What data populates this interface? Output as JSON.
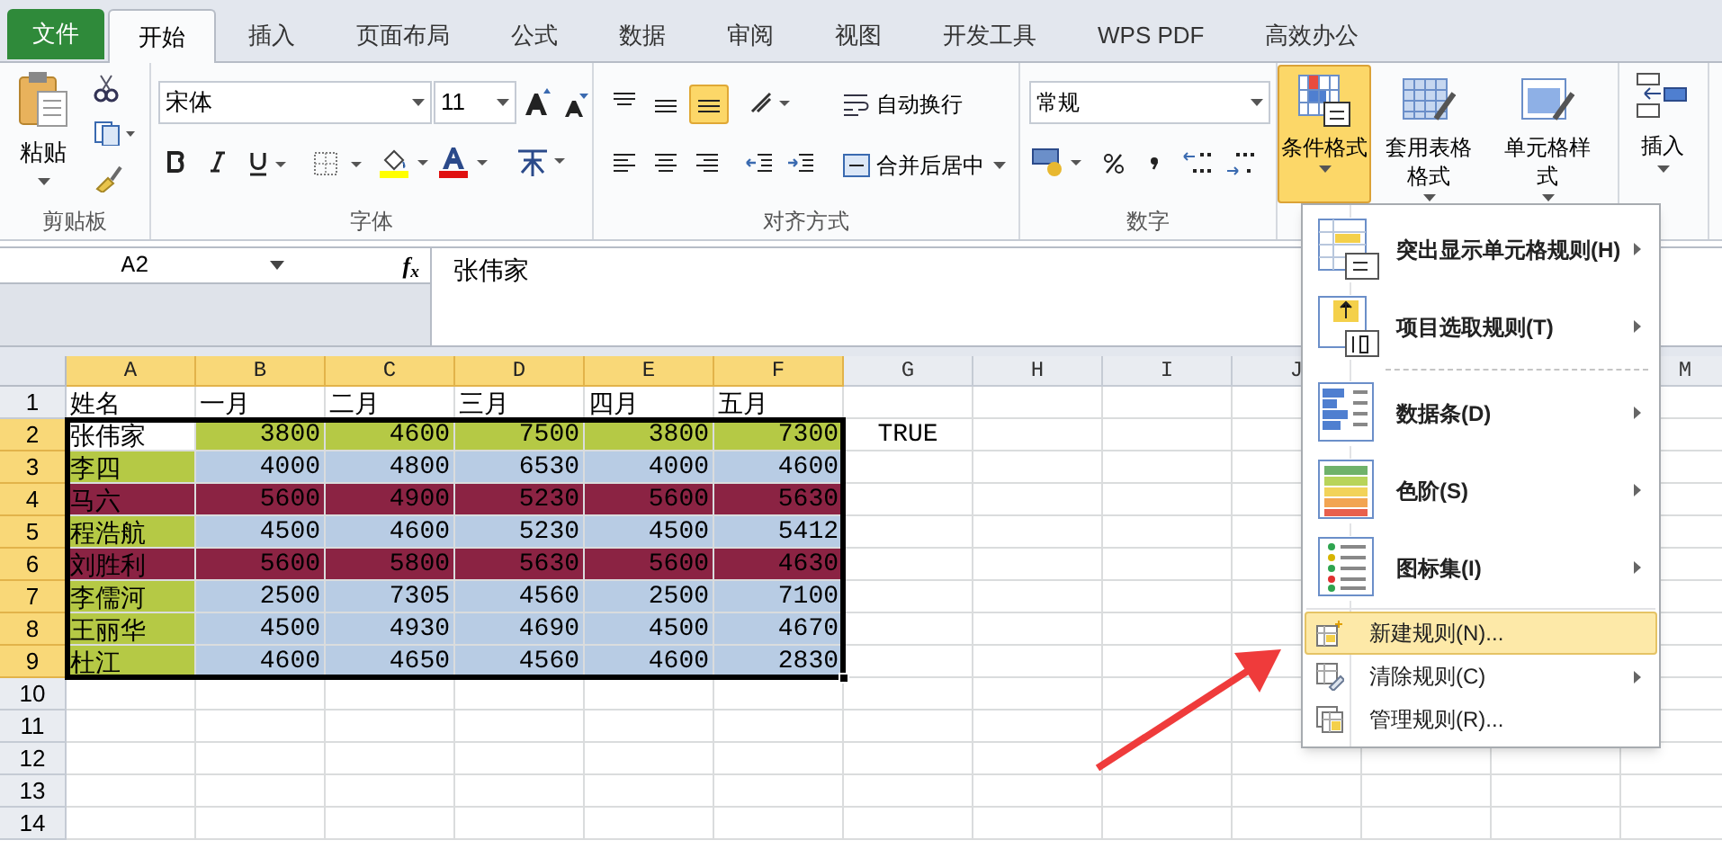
{
  "tabs": [
    {
      "label": "文件",
      "kind": "file",
      "selected": false
    },
    {
      "label": "开始",
      "kind": "tab",
      "selected": true
    },
    {
      "label": "插入",
      "kind": "tab",
      "selected": false
    },
    {
      "label": "页面布局",
      "kind": "tab",
      "selected": false
    },
    {
      "label": "公式",
      "kind": "tab",
      "selected": false
    },
    {
      "label": "数据",
      "kind": "tab",
      "selected": false
    },
    {
      "label": "审阅",
      "kind": "tab",
      "selected": false
    },
    {
      "label": "视图",
      "kind": "tab",
      "selected": false
    },
    {
      "label": "开发工具",
      "kind": "tab",
      "selected": false
    },
    {
      "label": "WPS PDF",
      "kind": "tab",
      "selected": false
    },
    {
      "label": "高效办公",
      "kind": "tab",
      "selected": false
    }
  ],
  "ribbon": {
    "clipboard": {
      "label": "剪贴板",
      "paste": "粘贴"
    },
    "font": {
      "label": "字体",
      "font_name": "宋体",
      "font_size": "11"
    },
    "alignment": {
      "label": "对齐方式",
      "wrap_text": "自动换行",
      "merge_center": "合并后居中"
    },
    "number": {
      "label": "数字",
      "format": "常规"
    },
    "styles": [
      {
        "label": "条件格式",
        "pressed": true
      },
      {
        "label": "套用表格格式",
        "pressed": false
      },
      {
        "label": "单元格样式",
        "pressed": false
      }
    ],
    "cells": {
      "insert": "插入"
    }
  },
  "name_box": "A2",
  "formula": "张伟家",
  "function_label": "f$_{x}$",
  "columns": [
    {
      "label": "A",
      "selected": true
    },
    {
      "label": "B",
      "selected": true
    },
    {
      "label": "C",
      "selected": true
    },
    {
      "label": "D",
      "selected": true
    },
    {
      "label": "E",
      "selected": true
    },
    {
      "label": "F",
      "selected": true
    },
    {
      "label": "G",
      "selected": false
    },
    {
      "label": "H",
      "selected": false
    },
    {
      "label": "I",
      "selected": false
    },
    {
      "label": "J",
      "selected": false
    },
    {
      "label": "M",
      "selected": false
    }
  ],
  "rows": [
    {
      "number": "1",
      "selected": false,
      "cells": [
        {
          "text": "姓名"
        },
        {
          "text": "一月"
        },
        {
          "text": "二月"
        },
        {
          "text": "三月"
        },
        {
          "text": "四月"
        },
        {
          "text": "五月"
        }
      ]
    },
    {
      "number": "2",
      "selected": true,
      "cells": [
        {
          "text": "张伟家",
          "color": "#ffffff"
        },
        {
          "text": "3800",
          "color": "#b5c945"
        },
        {
          "text": "4600",
          "color": "#b5c945"
        },
        {
          "text": "7500",
          "color": "#b5c945"
        },
        {
          "text": "3800",
          "color": "#b5c945"
        },
        {
          "text": "7300",
          "color": "#b5c945"
        },
        {
          "text": "TRUE"
        }
      ]
    },
    {
      "number": "3",
      "selected": true,
      "cells": [
        {
          "text": "李四",
          "color": "#b5c945"
        },
        {
          "text": "4000",
          "color": "#b8cce4"
        },
        {
          "text": "4800",
          "color": "#b8cce4"
        },
        {
          "text": "6530",
          "color": "#b8cce4"
        },
        {
          "text": "4000",
          "color": "#b8cce4"
        },
        {
          "text": "4600",
          "color": "#b8cce4"
        }
      ]
    },
    {
      "number": "4",
      "selected": true,
      "cells": [
        {
          "text": "马六",
          "color": "#8b2343"
        },
        {
          "text": "5600",
          "color": "#8b2343"
        },
        {
          "text": "4900",
          "color": "#8b2343"
        },
        {
          "text": "5230",
          "color": "#8b2343"
        },
        {
          "text": "5600",
          "color": "#8b2343"
        },
        {
          "text": "5630",
          "color": "#8b2343"
        }
      ]
    },
    {
      "number": "5",
      "selected": true,
      "cells": [
        {
          "text": "程浩航",
          "color": "#b5c945"
        },
        {
          "text": "4500",
          "color": "#b8cce4"
        },
        {
          "text": "4600",
          "color": "#b8cce4"
        },
        {
          "text": "5230",
          "color": "#b8cce4"
        },
        {
          "text": "4500",
          "color": "#b8cce4"
        },
        {
          "text": "5412",
          "color": "#b8cce4"
        }
      ]
    },
    {
      "number": "6",
      "selected": true,
      "cells": [
        {
          "text": "刘胜利",
          "color": "#8b2343"
        },
        {
          "text": "5600",
          "color": "#8b2343"
        },
        {
          "text": "5800",
          "color": "#8b2343"
        },
        {
          "text": "5630",
          "color": "#8b2343"
        },
        {
          "text": "5600",
          "color": "#8b2343"
        },
        {
          "text": "4630",
          "color": "#8b2343"
        }
      ]
    },
    {
      "number": "7",
      "selected": true,
      "cells": [
        {
          "text": "李儒河",
          "color": "#b5c945"
        },
        {
          "text": "2500",
          "color": "#b8cce4"
        },
        {
          "text": "7305",
          "color": "#b8cce4"
        },
        {
          "text": "4560",
          "color": "#b8cce4"
        },
        {
          "text": "2500",
          "color": "#b8cce4"
        },
        {
          "text": "7100",
          "color": "#b8cce4"
        }
      ]
    },
    {
      "number": "8",
      "selected": true,
      "cells": [
        {
          "text": "王丽华",
          "color": "#b5c945"
        },
        {
          "text": "4500",
          "color": "#b8cce4"
        },
        {
          "text": "4930",
          "color": "#b8cce4"
        },
        {
          "text": "4690",
          "color": "#b8cce4"
        },
        {
          "text": "4500",
          "color": "#b8cce4"
        },
        {
          "text": "4670",
          "color": "#b8cce4"
        }
      ]
    },
    {
      "number": "9",
      "selected": true,
      "cells": [
        {
          "text": "杜江",
          "color": "#b5c945"
        },
        {
          "text": "4600",
          "color": "#b8cce4"
        },
        {
          "text": "4650",
          "color": "#b8cce4"
        },
        {
          "text": "4560",
          "color": "#b8cce4"
        },
        {
          "text": "4600",
          "color": "#b8cce4"
        },
        {
          "text": "2830",
          "color": "#b8cce4"
        }
      ]
    },
    {
      "number": "10",
      "selected": false,
      "cells": []
    },
    {
      "number": "11",
      "selected": false,
      "cells": []
    },
    {
      "number": "12",
      "selected": false,
      "cells": []
    },
    {
      "number": "13",
      "selected": false,
      "cells": []
    },
    {
      "number": "14",
      "selected": false,
      "cells": []
    }
  ],
  "menu": [
    {
      "kind": "large",
      "label": "突出显示单元格规则(H)",
      "submenu": true,
      "selected": false
    },
    {
      "kind": "large",
      "label": "项目选取规则(T)",
      "submenu": true,
      "selected": false
    },
    {
      "kind": "large",
      "label": "数据条(D)",
      "submenu": true,
      "selected": false
    },
    {
      "kind": "large",
      "label": "色阶(S)",
      "submenu": true,
      "selected": false
    },
    {
      "kind": "large",
      "label": "图标集(I)",
      "submenu": true,
      "selected": false
    },
    {
      "kind": "small",
      "label": "新建规则(N)...",
      "submenu": false,
      "selected": true
    },
    {
      "kind": "small",
      "label": "清除规则(C)",
      "submenu": true,
      "selected": false
    },
    {
      "kind": "small",
      "label": "管理规则(R)...",
      "submenu": false,
      "selected": false
    }
  ]
}
